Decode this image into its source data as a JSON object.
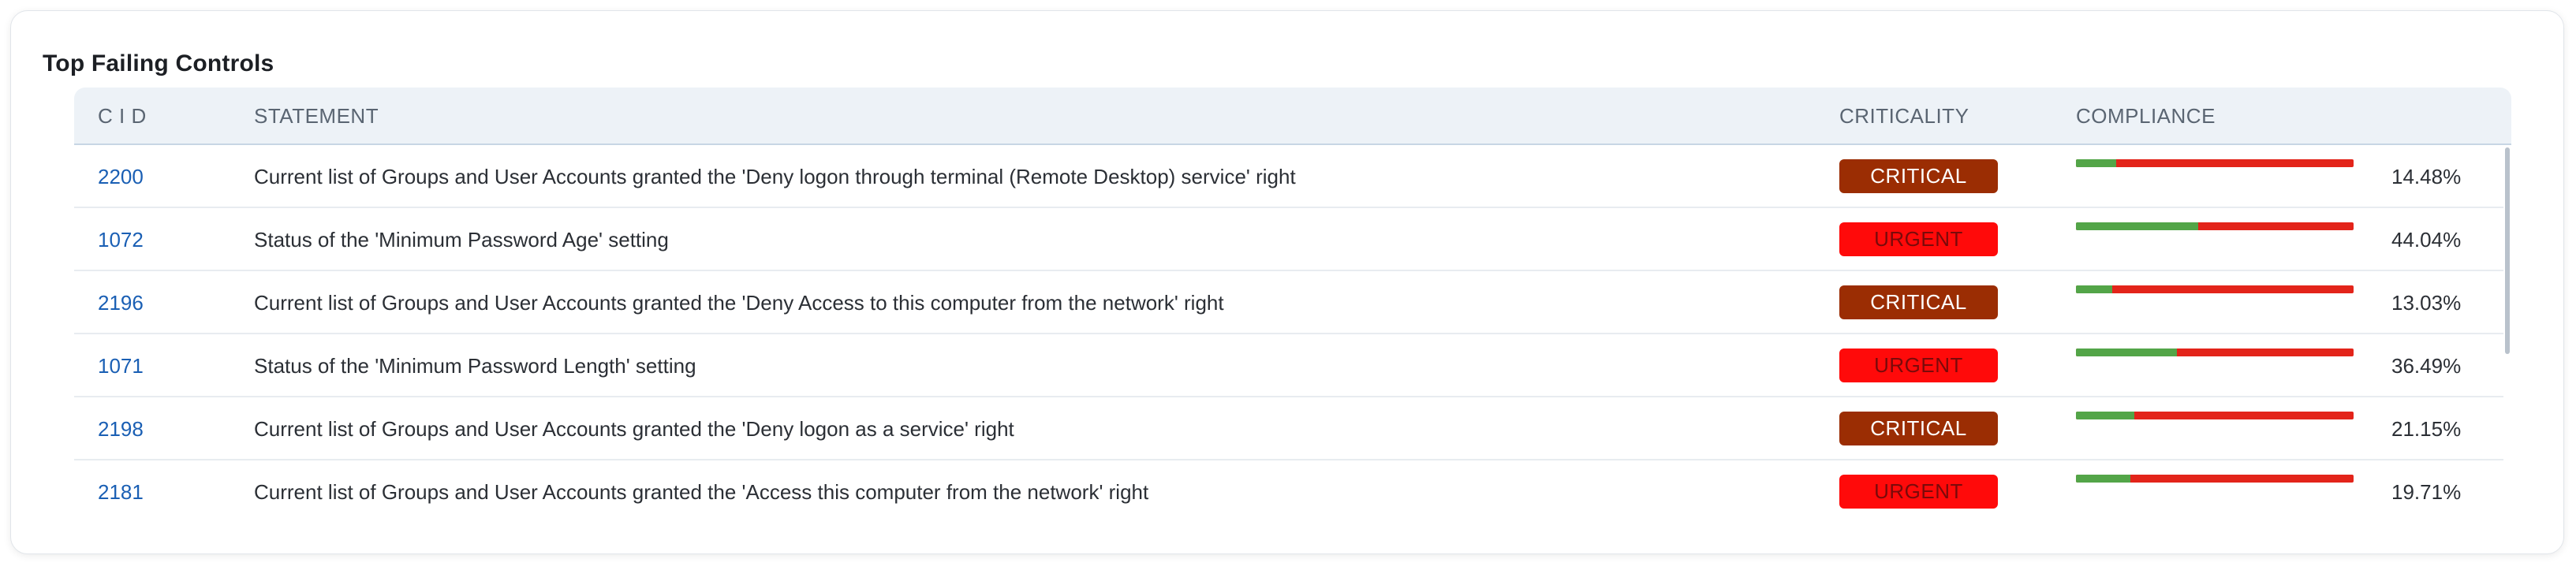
{
  "title": "Top Failing Controls",
  "columns": {
    "cid": "C I D",
    "statement": "STATEMENT",
    "criticality": "CRITICALITY",
    "compliance": "COMPLIANCE"
  },
  "colors": {
    "critical_bg": "#9b2d03",
    "critical_text": "#ffffff",
    "urgent_bg": "#ff0a0a",
    "urgent_text": "#7a0a0a",
    "pass": "#53a548",
    "fail": "#e3241a"
  },
  "rows": [
    {
      "cid": "2200",
      "statement": "Current list of Groups and User Accounts granted the 'Deny logon through terminal (Remote Desktop) service' right",
      "criticality": "CRITICAL",
      "compliance_pct": 14.48,
      "compliance_label": "14.48%"
    },
    {
      "cid": "1072",
      "statement": "Status of the 'Minimum Password Age' setting",
      "criticality": "URGENT",
      "compliance_pct": 44.04,
      "compliance_label": "44.04%"
    },
    {
      "cid": "2196",
      "statement": "Current list of Groups and User Accounts granted the 'Deny Access to this computer from the network' right",
      "criticality": "CRITICAL",
      "compliance_pct": 13.03,
      "compliance_label": "13.03%"
    },
    {
      "cid": "1071",
      "statement": "Status of the 'Minimum Password Length' setting",
      "criticality": "URGENT",
      "compliance_pct": 36.49,
      "compliance_label": "36.49%"
    },
    {
      "cid": "2198",
      "statement": "Current list of Groups and User Accounts granted the 'Deny logon as a service' right",
      "criticality": "CRITICAL",
      "compliance_pct": 21.15,
      "compliance_label": "21.15%"
    },
    {
      "cid": "2181",
      "statement": "Current list of Groups and User Accounts granted the 'Access this computer from the network' right",
      "criticality": "URGENT",
      "compliance_pct": 19.71,
      "compliance_label": "19.71%"
    }
  ]
}
